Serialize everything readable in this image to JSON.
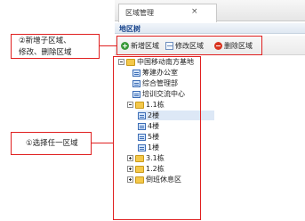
{
  "tab": {
    "title": "区域管理",
    "close": "×"
  },
  "panel": {
    "title": "地区树"
  },
  "toolbar": {
    "add": "新增区域",
    "edit": "修改区域",
    "delete": "删除区域"
  },
  "tree": {
    "root": "中国移动南方基地",
    "nodes": [
      "筹建办公室",
      "综合管理部",
      "培训交流中心",
      "1.1栋",
      "2楼",
      "4楼",
      "5楼",
      "1楼",
      "3.1栋",
      "1.2栋",
      "倒班休息区"
    ]
  },
  "annotations": {
    "callout_top_line1": "②新增子区域、",
    "callout_top_line2": "修改、删除区域",
    "callout_mid": "①选择任一区域"
  },
  "colors": {
    "annotation_red": "#e02020",
    "selection": "#dde8f6",
    "panel_title": "#15428b"
  }
}
